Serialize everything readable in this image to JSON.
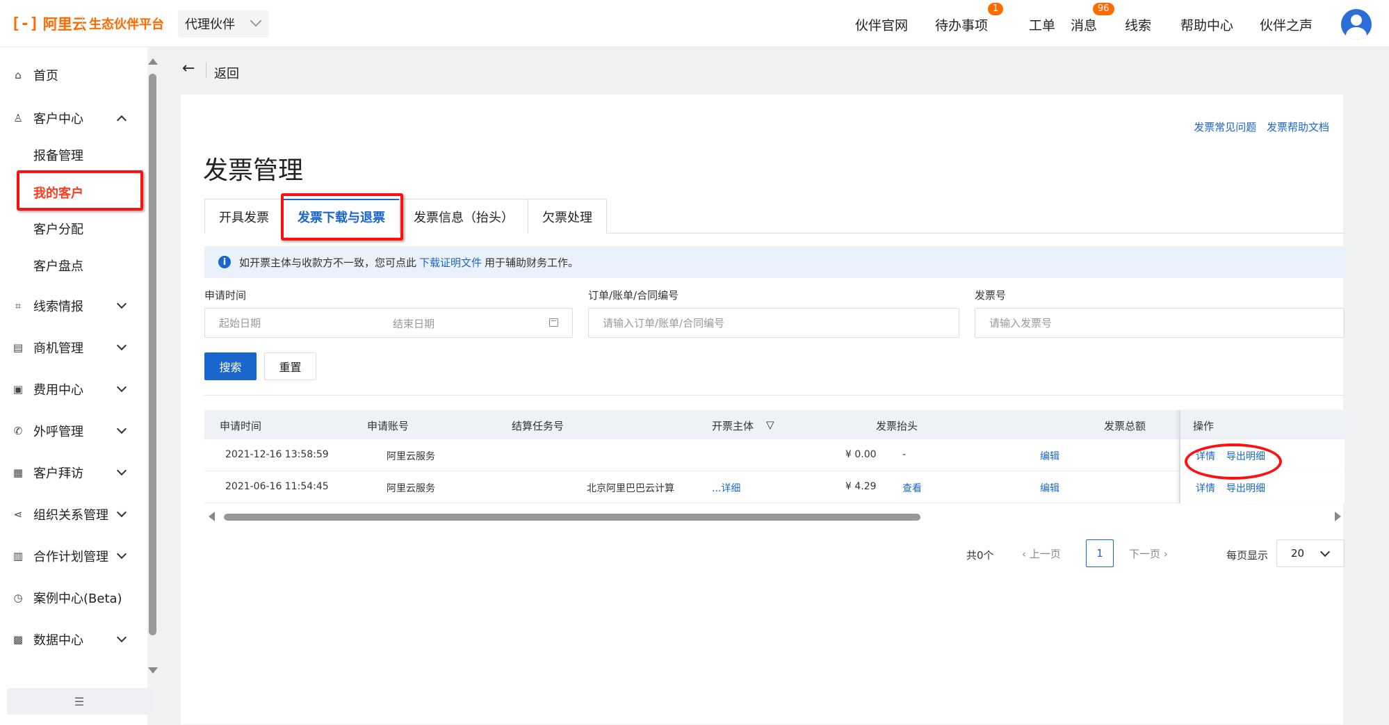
{
  "header": {
    "logo_text": "阿里云",
    "platform": "生态伙伴平台",
    "role": "代理伙伴",
    "nav": [
      {
        "label": "伙伴官网"
      },
      {
        "label": "待办事项",
        "badge": "1"
      },
      {
        "label": "工单"
      },
      {
        "label": "消息",
        "badge": "96"
      },
      {
        "label": "线索"
      },
      {
        "label": "帮助中心"
      },
      {
        "label": "伙伴之声"
      }
    ]
  },
  "sidebar": {
    "items": [
      {
        "label": "首页",
        "icon": "home-icon"
      },
      {
        "label": "客户中心",
        "icon": "user-icon",
        "expanded": true
      },
      {
        "label": "线索情报",
        "icon": "scan-icon"
      },
      {
        "label": "商机管理",
        "icon": "doc-icon"
      },
      {
        "label": "费用中心",
        "icon": "bill-icon"
      },
      {
        "label": "外呼管理",
        "icon": "phone-icon"
      },
      {
        "label": "客户拜访",
        "icon": "calendar-icon"
      },
      {
        "label": "组织关系管理",
        "icon": "share-icon"
      },
      {
        "label": "合作计划管理",
        "icon": "plan-icon"
      },
      {
        "label": "案例中心(Beta)",
        "icon": "case-icon"
      },
      {
        "label": "数据中心",
        "icon": "data-icon"
      }
    ],
    "sub_items": [
      "报备管理",
      "我的客户",
      "客户分配",
      "客户盘点"
    ],
    "active_sub": "我的客户"
  },
  "back": {
    "label": "返回"
  },
  "page": {
    "title": "发票管理",
    "help_links": [
      "发票常见问题",
      "发票帮助文档"
    ],
    "tabs": [
      "开具发票",
      "发票下载与退票",
      "发票信息（抬头）",
      "欠票处理"
    ],
    "active_tab": "发票下载与退票",
    "notice": {
      "text1": "如开票主体与收款方不一致，您可点此",
      "link": "下载证明文件",
      "text2": "用于辅助财务工作。"
    }
  },
  "filters": {
    "date_label": "申请时间",
    "start_placeholder": "起始日期",
    "end_placeholder": "结束日期",
    "order_label": "订单/账单/合同编号",
    "order_placeholder": "请输入订单/账单/合同编号",
    "invoice_label": "发票号",
    "invoice_placeholder": "请输入发票号",
    "search_btn": "搜索",
    "reset_btn": "重置"
  },
  "table": {
    "columns": [
      "申请时间",
      "申请账号",
      "结算任务号",
      "开票主体",
      "发票抬头",
      "发票总额",
      "操作"
    ],
    "rows": [
      {
        "time": "2021-12-16 13:58:59",
        "account": "阿里云服务",
        "task": "",
        "entity": "",
        "amount": "¥ 0.00",
        "title": "-",
        "edit": "编辑",
        "detail": "详情",
        "export": "导出明细"
      },
      {
        "time": "2021-06-16 11:54:45",
        "account": "阿里云服务",
        "task": "北京阿里巴巴云计算",
        "entity": "...详细",
        "amount": "¥ 4.29",
        "title": "查看",
        "edit": "编辑",
        "detail": "详情",
        "export": "导出明细"
      }
    ]
  },
  "pagination": {
    "total": "共0个",
    "prev": "上一页",
    "current": "1",
    "next": "下一页",
    "size_label": "每页显示",
    "size": "20"
  },
  "colors": {
    "brand": "#ff6a00",
    "primary": "#1a66cc",
    "highlight": "#ff1010"
  }
}
